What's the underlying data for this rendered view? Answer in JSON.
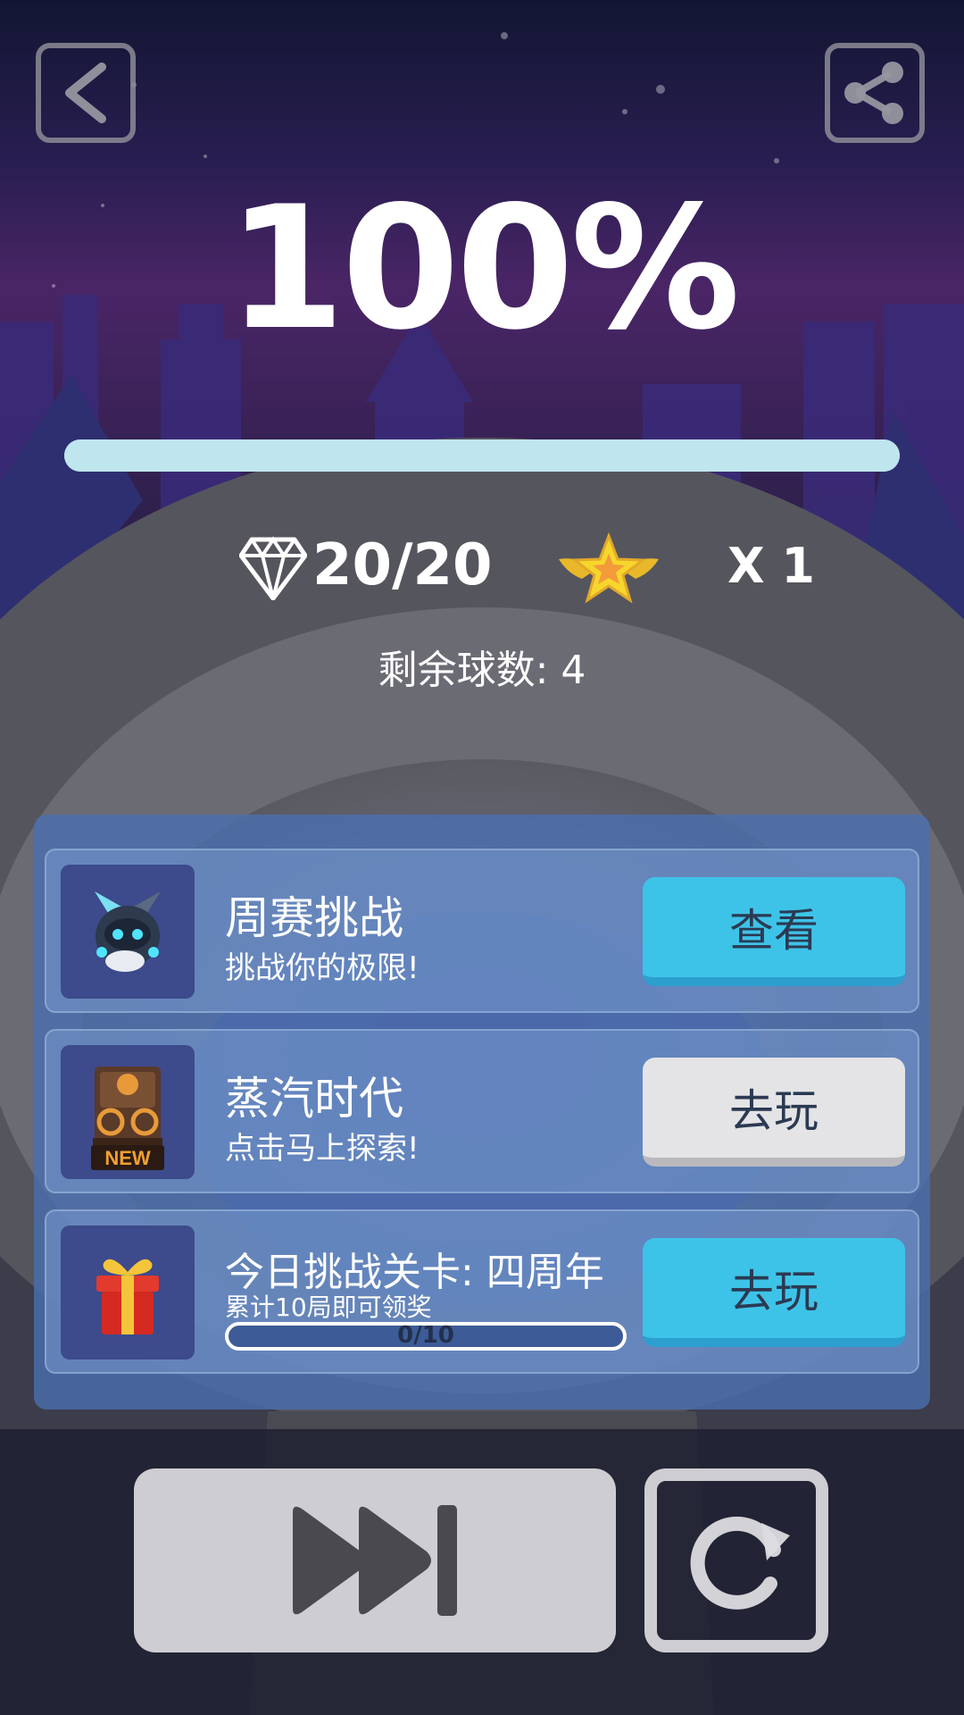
{
  "result": {
    "percent_label": "100%",
    "progress": 1.0,
    "gems_label": "20/20",
    "stars_label": "X 1",
    "balls_label": "剩余球数: 4"
  },
  "challenges": [
    {
      "title": "周赛挑战",
      "subtitle": "挑战你的极限!",
      "button_label": "查看",
      "button_style": "blue",
      "thumb_icon": "robot-icon"
    },
    {
      "title": "蒸汽时代",
      "subtitle": "点击马上探索!",
      "button_label": "去玩",
      "button_style": "grey",
      "thumb_icon": "steam-machine-new-icon"
    },
    {
      "title": "今日挑战关卡: 四周年",
      "subtitle": "累计10局即可领奖",
      "progress_label": "0/10",
      "progress": 0,
      "button_label": "去玩",
      "button_style": "blue",
      "thumb_icon": "gift-box-icon"
    }
  ],
  "icons": {
    "back": "back-arrow-icon",
    "share": "share-icon",
    "gem": "diamond-icon",
    "star": "winged-star-icon",
    "skip": "fast-forward-icon",
    "restart": "restart-icon"
  },
  "colors": {
    "accent_blue": "#3ec3e8",
    "progress": "#bfe5ee",
    "panel": "#4a70b2",
    "star": "#f5d327"
  }
}
